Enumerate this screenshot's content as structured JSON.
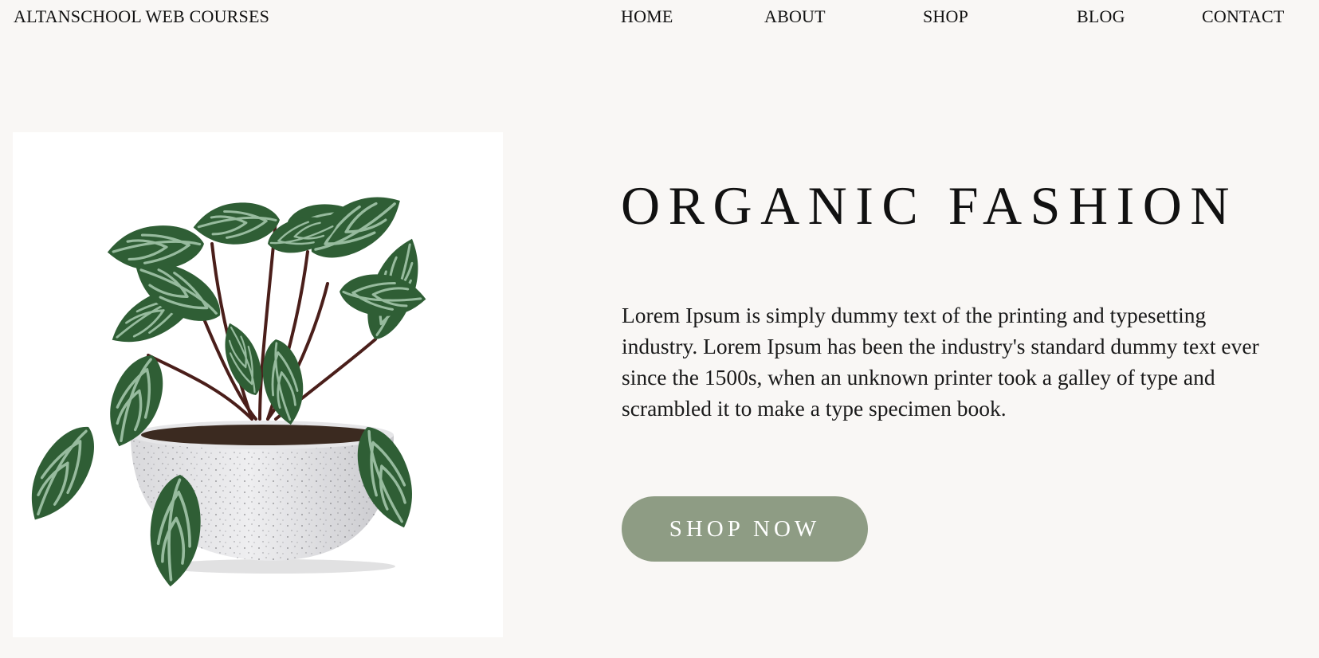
{
  "header": {
    "logo": "ALTANSCHOOL WEB COURSES",
    "nav": [
      {
        "label": "HOME"
      },
      {
        "label": "ABOUT"
      },
      {
        "label": "SHOP"
      },
      {
        "label": "BLOG"
      },
      {
        "label": "CONTACT"
      }
    ]
  },
  "hero": {
    "title": "ORGANIC FASHION",
    "body": "Lorem Ipsum is simply dummy text of the printing and typesetting industry. Lorem Ipsum has been the industry's standard dummy text ever since the 1500s, when an unknown printer took a galley of type and scrambled it to make a type specimen book.",
    "button_label": "SHOP NOW",
    "image_icon": "potted-plant-image"
  },
  "colors": {
    "page_background": "#f9f7f5",
    "image_background": "#ffffff",
    "button_background": "#8e9c84",
    "button_text": "#ffffff",
    "text": "#111111",
    "leaf_dark": "#2f5e35",
    "leaf_light": "#9fc4a3",
    "pot": "#e2e2e4"
  }
}
